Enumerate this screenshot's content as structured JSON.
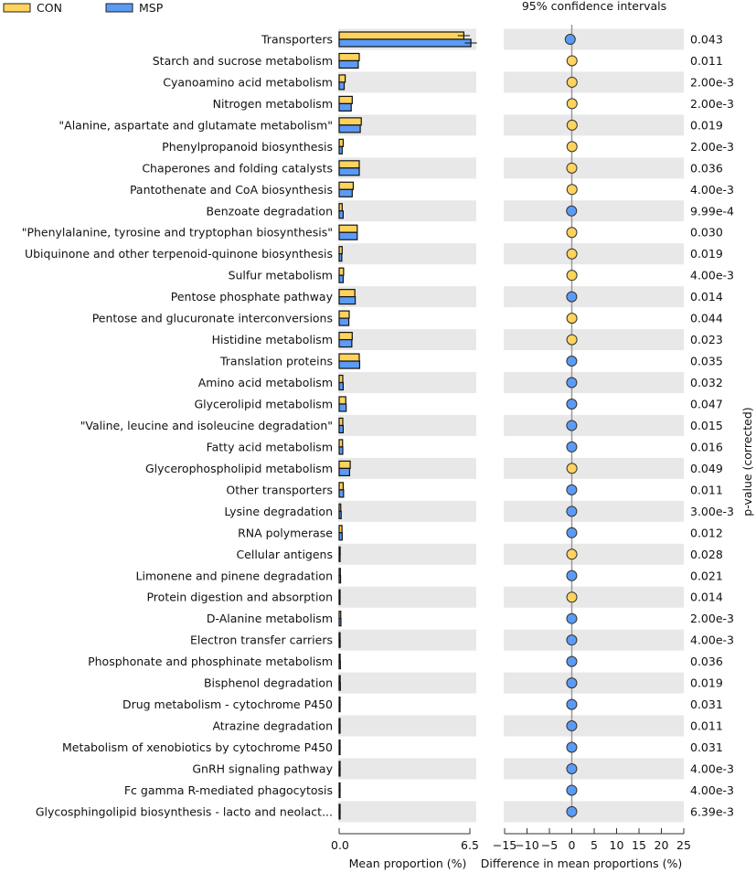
{
  "chart_data": {
    "type": "bar",
    "title": "95% confidence intervals",
    "legend": {
      "placement": "top-left",
      "entries": [
        {
          "name": "CON",
          "color": "#FFD35C"
        },
        {
          "name": "MSP",
          "color": "#5B9BF5"
        }
      ]
    },
    "colors": {
      "CON": "#FFD35C",
      "MSP": "#5B9BF5",
      "band": "#E8E8E8",
      "zero_line": "#999999"
    },
    "left_panel": {
      "xlabel": "Mean proportion (%)",
      "xlim": [
        0,
        6.8
      ],
      "ticks": [
        "0.0",
        "6.5"
      ],
      "tick_values": [
        0,
        6.5
      ]
    },
    "right_panel": {
      "xlabel": "Difference in mean proportions (%)",
      "xlim": [
        -15,
        25
      ],
      "ticks": [
        "−15",
        "−10",
        "−5",
        "0",
        "5",
        "10",
        "15",
        "20",
        "25"
      ],
      "tick_values": [
        -15,
        -10,
        -5,
        0,
        5,
        10,
        15,
        20,
        25
      ]
    },
    "pvalue_label": "p-value (corrected)",
    "categories": [
      "Transporters",
      "Starch and sucrose metabolism",
      "Cyanoamino acid metabolism",
      "Nitrogen metabolism",
      "\"Alanine, aspartate and glutamate metabolism\"",
      "Phenylpropanoid biosynthesis",
      "Chaperones and folding catalysts",
      "Pantothenate and CoA biosynthesis",
      "Benzoate degradation",
      "\"Phenylalanine, tyrosine and tryptophan biosynthesis\"",
      "Ubiquinone and other terpenoid-quinone biosynthesis",
      "Sulfur metabolism",
      "Pentose phosphate pathway",
      "Pentose and glucuronate interconversions",
      "Histidine metabolism",
      "Translation proteins",
      "Amino acid metabolism",
      "Glycerolipid metabolism",
      "\"Valine, leucine and isoleucine degradation\"",
      "Fatty acid metabolism",
      "Glycerophospholipid metabolism",
      "Other transporters",
      "Lysine degradation",
      "RNA polymerase",
      "Cellular antigens",
      "Limonene and pinene degradation",
      "Protein digestion and absorption",
      "D-Alanine metabolism",
      "Electron transfer carriers",
      "Phosphonate and phosphinate metabolism",
      "Bisphenol degradation",
      "Drug metabolism - cytochrome P450",
      "Atrazine degradation",
      "Metabolism of xenobiotics by cytochrome P450",
      "GnRH signaling pathway",
      "Fc gamma R-mediated phagocytosis",
      "Glycosphingolipid biosynthesis - lacto and neolact..."
    ],
    "series": [
      {
        "name": "CON",
        "values": [
          6.2,
          1.0,
          0.3,
          0.65,
          1.1,
          0.2,
          1.0,
          0.7,
          0.15,
          0.9,
          0.15,
          0.22,
          0.78,
          0.5,
          0.65,
          1.0,
          0.18,
          0.33,
          0.18,
          0.17,
          0.55,
          0.2,
          0.08,
          0.14,
          0.05,
          0.06,
          0.03,
          0.08,
          0.04,
          0.05,
          0.05,
          0.03,
          0.03,
          0.03,
          0.02,
          0.02,
          0.02
        ]
      },
      {
        "name": "MSP",
        "values": [
          6.55,
          0.95,
          0.25,
          0.6,
          1.05,
          0.15,
          1.0,
          0.65,
          0.2,
          0.9,
          0.13,
          0.2,
          0.8,
          0.48,
          0.63,
          1.02,
          0.2,
          0.35,
          0.2,
          0.18,
          0.52,
          0.22,
          0.1,
          0.15,
          0.04,
          0.07,
          0.02,
          0.09,
          0.05,
          0.06,
          0.06,
          0.04,
          0.04,
          0.04,
          0.03,
          0.03,
          0.03
        ]
      }
    ],
    "error_bars": {
      "Transporters": {
        "CON": 0.3,
        "MSP": 0.3
      }
    },
    "difference": [
      -0.35,
      0.05,
      0.05,
      0.05,
      0.06,
      0.05,
      0.0,
      0.05,
      -0.05,
      0.0,
      0.02,
      0.02,
      -0.02,
      0.02,
      0.02,
      -0.02,
      -0.02,
      -0.02,
      -0.02,
      -0.01,
      0.03,
      -0.02,
      -0.02,
      -0.01,
      0.01,
      -0.01,
      0.01,
      -0.01,
      -0.01,
      -0.01,
      -0.01,
      -0.01,
      -0.01,
      -0.01,
      -0.01,
      -0.01,
      -0.01
    ],
    "difference_group": [
      "MSP",
      "CON",
      "CON",
      "CON",
      "CON",
      "CON",
      "CON",
      "CON",
      "MSP",
      "CON",
      "CON",
      "CON",
      "MSP",
      "CON",
      "CON",
      "MSP",
      "MSP",
      "MSP",
      "MSP",
      "MSP",
      "CON",
      "MSP",
      "MSP",
      "MSP",
      "CON",
      "MSP",
      "CON",
      "MSP",
      "MSP",
      "MSP",
      "MSP",
      "MSP",
      "MSP",
      "MSP",
      "MSP",
      "MSP",
      "MSP"
    ],
    "p_values": [
      "0.043",
      "0.011",
      "2.00e-3",
      "2.00e-3",
      "0.019",
      "2.00e-3",
      "0.036",
      "4.00e-3",
      "9.99e-4",
      "0.030",
      "0.019",
      "4.00e-3",
      "0.014",
      "0.044",
      "0.023",
      "0.035",
      "0.032",
      "0.047",
      "0.015",
      "0.016",
      "0.049",
      "0.011",
      "3.00e-3",
      "0.012",
      "0.028",
      "0.021",
      "0.014",
      "2.00e-3",
      "4.00e-3",
      "0.036",
      "0.019",
      "0.031",
      "0.011",
      "0.031",
      "4.00e-3",
      "4.00e-3",
      "6.39e-3"
    ]
  }
}
